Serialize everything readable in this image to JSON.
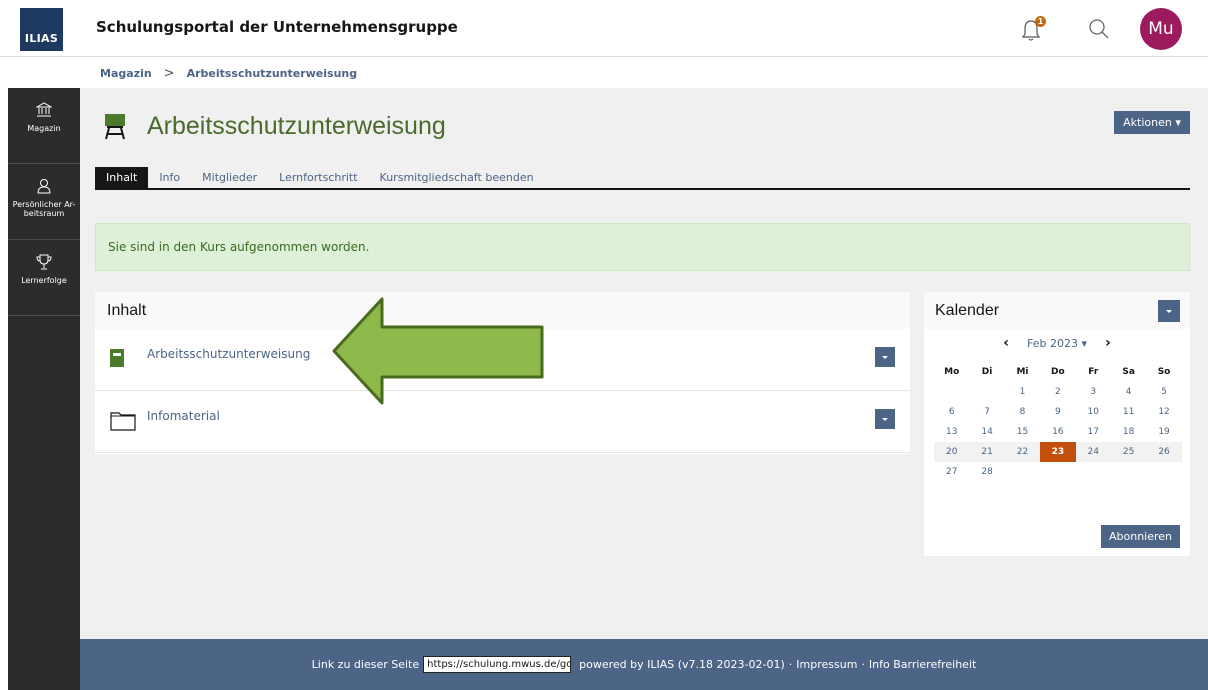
{
  "header": {
    "logo_text": "ILIAS",
    "portal_title": "Schulungsportal der Unternehmensgruppe",
    "notification_count": "1",
    "avatar_initials": "Mu",
    "avatar_color": "#9c1a5e"
  },
  "breadcrumb": [
    "Magazin",
    "Arbeitsschutzunterweisung"
  ],
  "slate": {
    "items": [
      {
        "label": "Magazin",
        "icon": "bank-icon"
      },
      {
        "label": "Persönlicher Ar-beitsraum",
        "icon": "user-icon"
      },
      {
        "label": "Lernerfolge",
        "icon": "trophy-icon"
      }
    ]
  },
  "course": {
    "title": "Arbeitsschutzunterweisung",
    "actions_label": "Aktionen ▾",
    "accent": "#4a6b2c"
  },
  "tabs": [
    {
      "label": "Inhalt",
      "active": true
    },
    {
      "label": "Info"
    },
    {
      "label": "Mitglieder"
    },
    {
      "label": "Lernfortschritt"
    },
    {
      "label": "Kursmitgliedschaft beenden"
    }
  ],
  "message": "Sie sind in den Kurs aufgenommen worden.",
  "content": {
    "heading": "Inhalt",
    "items": [
      {
        "label": "Arbeitsschutzunterweisung",
        "icon": "learning-module-icon"
      },
      {
        "label": "Infomaterial",
        "icon": "folder-icon"
      }
    ]
  },
  "calendar": {
    "heading": "Kalender",
    "month": "Feb 2023 ▾",
    "prev": "‹",
    "next": "›",
    "weekdays": [
      "Mo",
      "Di",
      "Mi",
      "Do",
      "Fr",
      "Sa",
      "So"
    ],
    "weeks": [
      [
        "",
        "",
        "1",
        "2",
        "3",
        "4",
        "5"
      ],
      [
        "6",
        "7",
        "8",
        "9",
        "10",
        "11",
        "12"
      ],
      [
        "13",
        "14",
        "15",
        "16",
        "17",
        "18",
        "19"
      ],
      [
        "20",
        "21",
        "22",
        "23",
        "24",
        "25",
        "26"
      ],
      [
        "27",
        "28",
        "",
        "",
        "",
        "",
        ""
      ]
    ],
    "today": "23",
    "subscribe_label": "Abonnieren"
  },
  "footer": {
    "link_label": "Link zu dieser Seite",
    "link_value": "https://schulung.mwus.de/goto.php",
    "powered": "powered by ILIAS (v7.18 2023-02-01)",
    "dot1": "·",
    "impressum": "Impressum",
    "dot2": "·",
    "accessibility": "Info Barrierefreiheit"
  },
  "colors": {
    "primary": "#4c6586",
    "success_bg": "#dff0d8",
    "today": "#c24f0b",
    "arrow_fill": "#8db84a"
  }
}
